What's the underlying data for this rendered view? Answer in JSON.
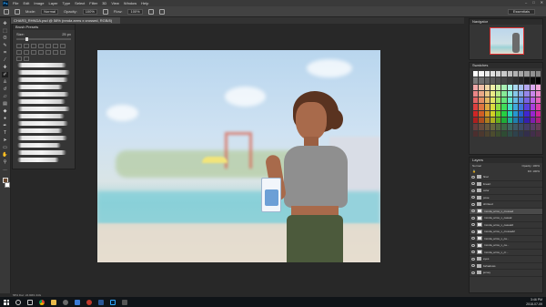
{
  "menubar": {
    "app_badge": "Ps",
    "items": [
      "File",
      "Edit",
      "Image",
      "Layer",
      "Type",
      "Select",
      "Filter",
      "3D",
      "View",
      "Window",
      "Help"
    ],
    "window_controls": [
      "–",
      "□",
      "✕"
    ]
  },
  "options": {
    "mode_label": "Mode:",
    "mode_value": "Normal",
    "opacity_label": "Opacity:",
    "opacity_value": "100%",
    "flow_label": "Flow:",
    "flow_value": "100%",
    "workspace": "Essentials"
  },
  "document_tab": "CHAR3_RHNDA.psd @ 58% (nmda arms x crossed, RGB/8)",
  "brush_panel": {
    "title": "Brush Presets",
    "size_label": "Size:",
    "size_value": "25 px"
  },
  "panels": {
    "navigator": "Navigator",
    "swatches": "Swatches",
    "layers": "Layers"
  },
  "layers": {
    "blend_mode": "Normal",
    "opacity_label": "Opacity:",
    "opacity_value": "100%",
    "fill_label": "Fill:",
    "fill_value": "100%",
    "items": [
      {
        "name": "final",
        "kind": "folder",
        "selected": false
      },
      {
        "name": "lineart",
        "kind": "folder",
        "selected": false
      },
      {
        "name": "color",
        "kind": "folder",
        "selected": false
      },
      {
        "name": "pose",
        "kind": "folder",
        "selected": false
      },
      {
        "name": "shirtsed",
        "kind": "folder",
        "selected": false
      },
      {
        "name": "rnmda_arms_x_crossed",
        "kind": "layer",
        "selected": true
      },
      {
        "name": "rnmda_arms_x_casual",
        "kind": "layer",
        "selected": false
      },
      {
        "name": "rnmda_arms_x_casual2",
        "kind": "layer",
        "selected": false
      },
      {
        "name": "rnmda_arms_x_crossed2",
        "kind": "layer",
        "selected": false
      },
      {
        "name": "rnmda_arms_x_ca...",
        "kind": "layer",
        "selected": false
      },
      {
        "name": "rnmda_arms_x_ca...",
        "kind": "layer",
        "selected": false
      },
      {
        "name": "rnmda_arms_x_cr...",
        "kind": "layer",
        "selected": false
      },
      {
        "name": "eyes",
        "kind": "folder",
        "selected": false
      },
      {
        "name": "bshadows",
        "kind": "folder",
        "selected": false
      },
      {
        "name": "jersey",
        "kind": "folder",
        "selected": false
      }
    ]
  },
  "status": "58%   Doc: 24.9M/1.34G",
  "taskbar": {
    "time": "3:46 PM",
    "date": "2018-07-09"
  },
  "colors": {
    "app_bg": "#282828",
    "panel_bg": "#353535",
    "accent": "#31a8ff",
    "foreground_swatch": "#6b4a2f",
    "background_swatch": "#ffffff"
  }
}
